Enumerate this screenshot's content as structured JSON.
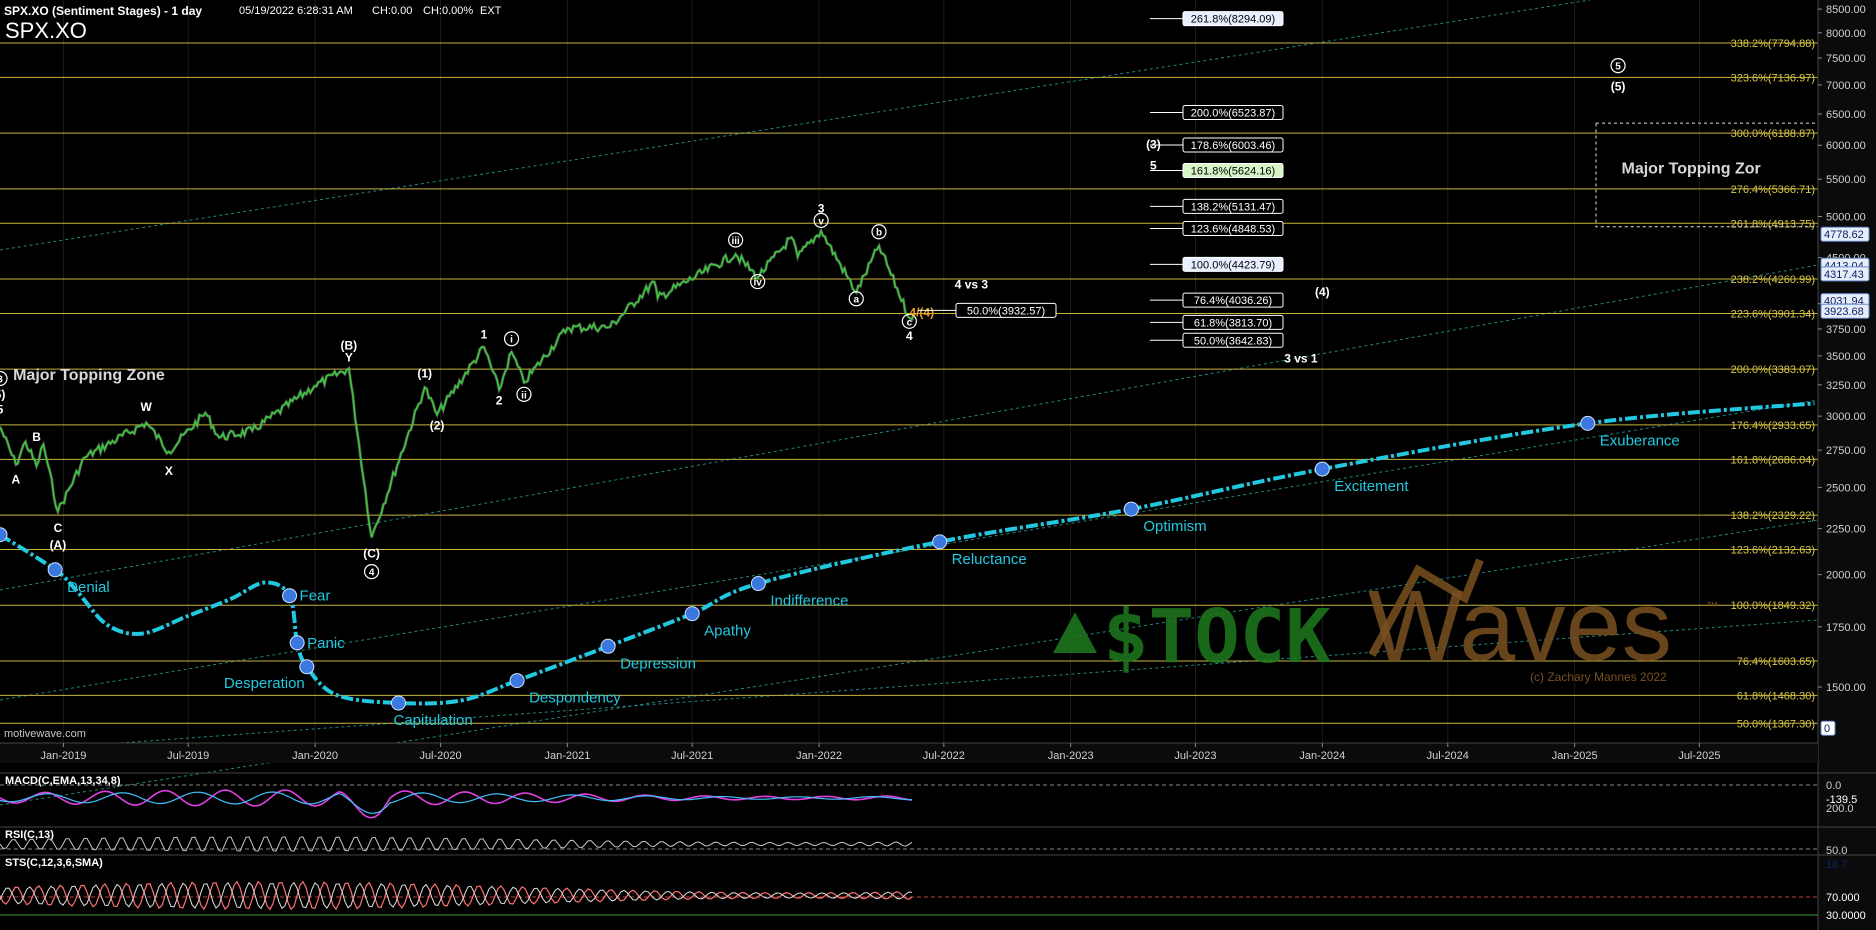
{
  "header": {
    "title_line": "SPX.XO (Sentiment Stages) - 1 day",
    "timestamp": "05/19/2022 6:28:31 AM",
    "change": "CH:0.00",
    "change_pct": "CH:0.00%",
    "session": "EXT",
    "symbol": "SPX.XO"
  },
  "watermark": {
    "brand_left": "$TOCK",
    "brand_right": "Waves",
    "trademark": "™",
    "copyright": "(c) Zachary Mannes 2022",
    "source": "motivewave.com"
  },
  "colors": {
    "fib_line": "#c8b43c",
    "fib_label": "#d8c84a",
    "sentiment_curve": "#22c8e0",
    "trend_channel": "#2aa6a0",
    "price_up": "#3cc83c",
    "price_down": "#e0e0e0",
    "wave_label": "#ffffff",
    "watermark_green": "#1e7a1e",
    "watermark_brown": "#7a5020"
  },
  "chart_data": [
    {
      "type": "line",
      "title": "SPX.XO (Sentiment Stages) - 1 day",
      "yscale": "log",
      "ylim": [
        1300,
        8700
      ],
      "xlim": [
        "2018-10-01",
        "2025-12-20"
      ],
      "y_ticks": [
        "8500.00",
        "8000.00",
        "7500.00",
        "7000.00",
        "6500.00",
        "6000.00",
        "5500.00",
        "5000.00",
        "4500.00",
        "4000.00",
        "3750.00",
        "3500.00",
        "3250.00",
        "3000.00",
        "2750.00",
        "2500.00",
        "2250.00",
        "2000.00",
        "1750.00",
        "1500.00"
      ],
      "y_tick_values": [
        8500,
        8000,
        7500,
        7000,
        6500,
        6000,
        5500,
        5000,
        4500,
        4000,
        3750,
        3500,
        3250,
        3000,
        2750,
        2500,
        2250,
        2000,
        1750,
        1500
      ],
      "x_ticks": [
        "Jan-2019",
        "Jul-2019",
        "Jan-2020",
        "Jul-2020",
        "Jan-2021",
        "Jul-2021",
        "Jan-2022",
        "Jul-2022",
        "Jan-2023",
        "Jul-2023",
        "Jan-2024",
        "Jul-2024",
        "Jan-2025",
        "Jul-2025"
      ],
      "x_tick_dates": [
        "2019-01-01",
        "2019-07-01",
        "2020-01-01",
        "2020-07-01",
        "2021-01-01",
        "2021-07-01",
        "2022-01-01",
        "2022-07-01",
        "2023-01-01",
        "2023-07-01",
        "2024-01-01",
        "2024-07-01",
        "2025-01-01",
        "2025-07-01"
      ],
      "price_axis_badges": [
        {
          "label": "4778.62",
          "value": 4778.62
        },
        {
          "label": "4413.04",
          "value": 4413.04
        },
        {
          "label": "4317.43",
          "value": 4317.43
        },
        {
          "label": "4031.94",
          "value": 4031.94
        },
        {
          "label": "3923.68",
          "value": 3923.68
        },
        {
          "label": "0",
          "value": 1350
        }
      ],
      "price_series": {
        "name": "SPX.XO",
        "points": [
          [
            "2018-10-01",
            2920
          ],
          [
            "2018-10-24",
            2650
          ],
          [
            "2018-11-07",
            2810
          ],
          [
            "2018-11-23",
            2640
          ],
          [
            "2018-12-03",
            2790
          ],
          [
            "2018-12-24",
            2350
          ],
          [
            "2019-02-01",
            2700
          ],
          [
            "2019-05-01",
            2950
          ],
          [
            "2019-06-03",
            2740
          ],
          [
            "2019-07-26",
            3025
          ],
          [
            "2019-08-15",
            2840
          ],
          [
            "2019-10-02",
            2890
          ],
          [
            "2019-12-31",
            3240
          ],
          [
            "2020-02-19",
            3390
          ],
          [
            "2020-03-23",
            2200
          ],
          [
            "2020-06-08",
            3230
          ],
          [
            "2020-06-26",
            3010
          ],
          [
            "2020-09-02",
            3580
          ],
          [
            "2020-09-24",
            3210
          ],
          [
            "2020-10-12",
            3535
          ],
          [
            "2020-10-30",
            3270
          ],
          [
            "2021-01-01",
            3760
          ],
          [
            "2021-03-04",
            3770
          ],
          [
            "2021-05-07",
            4230
          ],
          [
            "2021-05-12",
            4060
          ],
          [
            "2021-09-02",
            4540
          ],
          [
            "2021-10-04",
            4280
          ],
          [
            "2021-11-22",
            4740
          ],
          [
            "2021-12-01",
            4510
          ],
          [
            "2022-01-04",
            4818
          ],
          [
            "2022-02-24",
            4115
          ],
          [
            "2022-03-29",
            4637
          ],
          [
            "2022-05-12",
            3860
          ],
          [
            "2022-05-19",
            3900
          ]
        ]
      },
      "sentiment_curve": {
        "name": "Sentiment Stages",
        "points": [
          [
            "2018-10-01",
            2215
          ],
          [
            "2018-12-20",
            2025
          ],
          [
            "2019-01-20",
            1920
          ],
          [
            "2019-03-05",
            1760
          ],
          [
            "2019-04-25",
            1720
          ],
          [
            "2019-07-01",
            1800
          ],
          [
            "2019-09-01",
            1880
          ],
          [
            "2019-10-20",
            1960
          ],
          [
            "2019-11-25",
            1895
          ],
          [
            "2019-12-06",
            1680
          ],
          [
            "2019-12-20",
            1580
          ],
          [
            "2020-02-01",
            1470
          ],
          [
            "2020-05-01",
            1440
          ],
          [
            "2020-08-01",
            1450
          ],
          [
            "2020-10-20",
            1525
          ],
          [
            "2021-03-01",
            1665
          ],
          [
            "2021-07-01",
            1810
          ],
          [
            "2021-10-05",
            1955
          ],
          [
            "2022-06-25",
            2175
          ],
          [
            "2023-03-30",
            2365
          ],
          [
            "2024-01-01",
            2620
          ],
          [
            "2025-01-20",
            2945
          ],
          [
            "2025-12-15",
            3100
          ]
        ]
      },
      "sentiment_stages": [
        {
          "label": "Denial",
          "date": "2018-12-20",
          "value": 2025
        },
        {
          "label": "Fear",
          "date": "2019-11-25",
          "value": 1895
        },
        {
          "label": "Panic",
          "date": "2019-12-06",
          "value": 1680
        },
        {
          "label": "Desperation",
          "date": "2019-12-20",
          "value": 1580
        },
        {
          "label": "Capitulation",
          "date": "2020-05-01",
          "value": 1440
        },
        {
          "label": "Despondency",
          "date": "2020-10-20",
          "value": 1525
        },
        {
          "label": "Depression",
          "date": "2021-03-01",
          "value": 1665
        },
        {
          "label": "Apathy",
          "date": "2021-07-01",
          "value": 1810
        },
        {
          "label": "Indifference",
          "date": "2021-10-05",
          "value": 1955
        },
        {
          "label": "Reluctance",
          "date": "2022-06-25",
          "value": 2175
        },
        {
          "label": "Optimism",
          "date": "2023-03-30",
          "value": 2365
        },
        {
          "label": "Excitement",
          "date": "2024-01-01",
          "value": 2620
        },
        {
          "label": "Exuberance",
          "date": "2025-01-20",
          "value": 2945
        }
      ],
      "fib_extension_lines": [
        {
          "label": "338.2%(7794.88)",
          "value": 7794.88
        },
        {
          "label": "323.6%(7136.97)",
          "value": 7136.97
        },
        {
          "label": "300.0%(6188.87)",
          "value": 6188.87
        },
        {
          "label": "276.4%(5366.71)",
          "value": 5366.71
        },
        {
          "label": "261.8%(4913.75)",
          "value": 4913.75
        },
        {
          "label": "238.2%(4260.99)",
          "value": 4260.99
        },
        {
          "label": "223.6%(3901.34)",
          "value": 3901.34
        },
        {
          "label": "200.0%(3383.07)",
          "value": 3383.07
        },
        {
          "label": "176.4%(2933.65)",
          "value": 2933.65
        },
        {
          "label": "161.8%(2686.04)",
          "value": 2686.04
        },
        {
          "label": "138.2%(2329.22)",
          "value": 2329.22
        },
        {
          "label": "123.6%(2132.63)",
          "value": 2132.63
        },
        {
          "label": "100.0%(1849.32)",
          "value": 1849.32
        },
        {
          "label": "76.4%(1603.65)",
          "value": 1603.65
        },
        {
          "label": "61.8%(1468.30)",
          "value": 1468.3
        },
        {
          "label": "50.0%(1367.30)",
          "value": 1367.3
        }
      ],
      "target_boxes": [
        {
          "label": "261.8%(8294.09)",
          "value": 8294.09,
          "style": "white",
          "group": "upper"
        },
        {
          "label": "200.0%(6523.87)",
          "value": 6523.87,
          "style": "dark",
          "group": "upper"
        },
        {
          "label": "178.6%(6003.46)",
          "value": 6003.46,
          "style": "dark",
          "group": "upper"
        },
        {
          "label": "161.8%(5624.16)",
          "value": 5624.16,
          "style": "green",
          "group": "upper"
        },
        {
          "label": "138.2%(5131.47)",
          "value": 5131.47,
          "style": "dark",
          "group": "upper"
        },
        {
          "label": "123.6%(4848.53)",
          "value": 4848.53,
          "style": "dark",
          "group": "upper"
        },
        {
          "label": "100.0%(4423.79)",
          "value": 4423.79,
          "style": "white",
          "group": "upper"
        },
        {
          "label": "76.4%(4036.26)",
          "value": 4036.26,
          "style": "dark",
          "group": "upper"
        },
        {
          "label": "61.8%(3813.70)",
          "value": 3813.7,
          "style": "dark",
          "group": "upper"
        },
        {
          "label": "50.0%(3642.83)",
          "value": 3642.83,
          "style": "dark",
          "group": "upper"
        },
        {
          "label": "50.0%(3932.57)",
          "value": 3932.57,
          "style": "dark",
          "group": "retrace"
        }
      ],
      "zone_labels": [
        {
          "text": "Major Topping Zone",
          "date": "2018-10-20",
          "value": 3290
        },
        {
          "text": "Major Topping Zor",
          "date": "2025-03-10",
          "value": 5580
        }
      ],
      "topping_zone_box": {
        "date_from": "2025-02-01",
        "date_to": "2025-12-20",
        "value_from": 4870,
        "value_to": 6350
      },
      "wave_labels": [
        {
          "text": "3",
          "date": "2018-10-01",
          "value": 3270,
          "circled": true
        },
        {
          "text": "5)",
          "date": "2018-10-01",
          "value": 3140
        },
        {
          "text": "5",
          "date": "2018-10-01",
          "value": 3020
        },
        {
          "text": "B",
          "date": "2018-11-23",
          "value": 2815
        },
        {
          "text": "A",
          "date": "2018-10-24",
          "value": 2525
        },
        {
          "text": "C",
          "date": "2018-12-24",
          "value": 2230
        },
        {
          "text": "(A)",
          "date": "2018-12-24",
          "value": 2135
        },
        {
          "text": "W",
          "date": "2019-05-01",
          "value": 3040
        },
        {
          "text": "X",
          "date": "2019-06-03",
          "value": 2580
        },
        {
          "text": "(B)",
          "date": "2020-02-19",
          "value": 3560
        },
        {
          "text": "Y",
          "date": "2020-02-19",
          "value": 3450
        },
        {
          "text": "(C)",
          "date": "2020-03-23",
          "value": 2090
        },
        {
          "text": "4",
          "date": "2020-03-23",
          "value": 1995,
          "circled": true
        },
        {
          "text": "(1)",
          "date": "2020-06-08",
          "value": 3310
        },
        {
          "text": "(2)",
          "date": "2020-06-26",
          "value": 2900
        },
        {
          "text": "1",
          "date": "2020-09-02",
          "value": 3660
        },
        {
          "text": "2",
          "date": "2020-09-24",
          "value": 3090
        },
        {
          "text": "i",
          "date": "2020-10-12",
          "value": 3620,
          "circled": true
        },
        {
          "text": "ii",
          "date": "2020-10-30",
          "value": 3140,
          "circled": true
        },
        {
          "text": "iii",
          "date": "2021-09-02",
          "value": 4660,
          "circled": true
        },
        {
          "text": "iv",
          "date": "2021-10-04",
          "value": 4190,
          "circled": true
        },
        {
          "text": "3",
          "date": "2022-01-04",
          "value": 5050
        },
        {
          "text": "v",
          "date": "2022-01-04",
          "value": 4900,
          "circled": true
        },
        {
          "text": "a",
          "date": "2022-02-24",
          "value": 4010,
          "circled": true
        },
        {
          "text": "b",
          "date": "2022-03-29",
          "value": 4760,
          "circled": true
        },
        {
          "text": "c",
          "date": "2022-05-12",
          "value": 3785,
          "circled": true
        },
        {
          "text": "4",
          "date": "2022-05-12",
          "value": 3645
        },
        {
          "text": "4/(4)",
          "date": "2022-05-30",
          "value": 3870,
          "color": "#e8a020"
        },
        {
          "text": "4 vs 3",
          "date": "2022-08-10",
          "value": 4160
        },
        {
          "text": "(4)",
          "date": "2024-01-01",
          "value": 4080
        },
        {
          "text": "3 vs 1",
          "date": "2023-12-01",
          "value": 3440
        },
        {
          "text": "(3)",
          "date": "2023-05-01",
          "value": 5950
        },
        {
          "text": "5",
          "date": "2023-05-01",
          "value": 5640
        },
        {
          "text": "5",
          "date": "2025-03-05",
          "value": 7280,
          "circled": true
        },
        {
          "text": "(5)",
          "date": "2025-03-05",
          "value": 6900
        }
      ]
    },
    {
      "type": "line",
      "title": "MACD(C,EMA,13,34,8)",
      "y_ticks": [
        "0.0",
        "-139.5",
        "200.0"
      ],
      "series": [
        {
          "name": "MACD"
        },
        {
          "name": "Signal"
        }
      ]
    },
    {
      "type": "line",
      "title": "RSI(C,13)",
      "y_ticks": [
        "50.0",
        "18.7"
      ],
      "series": [
        {
          "name": "RSI"
        }
      ]
    },
    {
      "type": "line",
      "title": "STS(C,12,3,6,SMA)",
      "y_ticks": [
        "70.000",
        "30.0000"
      ],
      "series": [
        {
          "name": "%K"
        },
        {
          "name": "%D"
        }
      ]
    }
  ]
}
